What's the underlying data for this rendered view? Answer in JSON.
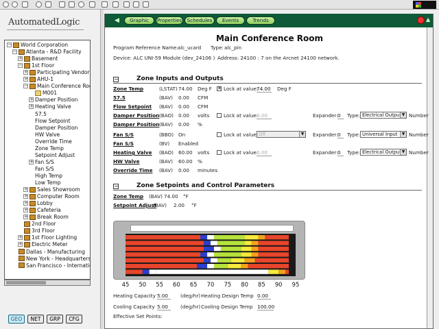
{
  "left": {
    "brand": "AutomatedLogic",
    "tree": [
      {
        "label": "World Corporation",
        "depth": 0,
        "exp": "−",
        "icon": "folder"
      },
      {
        "label": "Atlanta - R&D Facility",
        "depth": 1,
        "exp": "−",
        "icon": "folder"
      },
      {
        "label": "Basement",
        "depth": 2,
        "exp": "+",
        "icon": "folder"
      },
      {
        "label": "1st Floor",
        "depth": 2,
        "exp": "−",
        "icon": "folder"
      },
      {
        "label": "Participating Vendors",
        "depth": 3,
        "exp": "+",
        "icon": "folder"
      },
      {
        "label": "AHU-1",
        "depth": 3,
        "exp": "+",
        "icon": "folder"
      },
      {
        "label": "Main Conference Room",
        "depth": 3,
        "exp": "−",
        "icon": "folder"
      },
      {
        "label": "M001",
        "depth": 4,
        "exp": "",
        "icon": "box"
      },
      {
        "label": "Damper Position",
        "depth": 4,
        "exp": "+",
        "icon": ""
      },
      {
        "label": "Heating Valve",
        "depth": 4,
        "exp": "+",
        "icon": ""
      },
      {
        "label": "57.5",
        "depth": 4,
        "exp": "",
        "icon": ""
      },
      {
        "label": "Flow Setpoint",
        "depth": 4,
        "exp": "",
        "icon": ""
      },
      {
        "label": "Damper Position",
        "depth": 4,
        "exp": "",
        "icon": ""
      },
      {
        "label": "HW Valve",
        "depth": 4,
        "exp": "",
        "icon": ""
      },
      {
        "label": "Override Time",
        "depth": 4,
        "exp": "",
        "icon": ""
      },
      {
        "label": "Zone Temp",
        "depth": 4,
        "exp": "",
        "icon": ""
      },
      {
        "label": "Setpoint Adjust",
        "depth": 4,
        "exp": "",
        "icon": ""
      },
      {
        "label": "Fan S/S",
        "depth": 4,
        "exp": "+",
        "icon": ""
      },
      {
        "label": "Fan S/S",
        "depth": 4,
        "exp": "",
        "icon": ""
      },
      {
        "label": "High Temp",
        "depth": 4,
        "exp": "",
        "icon": ""
      },
      {
        "label": "Low Temp",
        "depth": 4,
        "exp": "",
        "icon": ""
      },
      {
        "label": "Sales Showroom",
        "depth": 3,
        "exp": "+",
        "icon": "folder"
      },
      {
        "label": "Computer Room",
        "depth": 3,
        "exp": "+",
        "icon": "folder"
      },
      {
        "label": "Lobby",
        "depth": 3,
        "exp": "+",
        "icon": "folder"
      },
      {
        "label": "Cafeteria",
        "depth": 3,
        "exp": "+",
        "icon": "folder"
      },
      {
        "label": "Break Room",
        "depth": 3,
        "exp": "+",
        "icon": "folder"
      },
      {
        "label": "2nd Floor",
        "depth": 2,
        "exp": "",
        "icon": "folder"
      },
      {
        "label": "3rd Floor",
        "depth": 2,
        "exp": "",
        "icon": "folder"
      },
      {
        "label": "1st Floor Lighting",
        "depth": 2,
        "exp": "+",
        "icon": "folder"
      },
      {
        "label": "Electric Meter",
        "depth": 2,
        "exp": "+",
        "icon": "folder"
      },
      {
        "label": "Dallas - Manufacturing",
        "depth": 1,
        "exp": "",
        "icon": "folder"
      },
      {
        "label": "New York - Headquarters",
        "depth": 1,
        "exp": "",
        "icon": "folder"
      },
      {
        "label": "San Francisco - International",
        "depth": 1,
        "exp": "",
        "icon": "folder"
      }
    ],
    "tabs": [
      "GEO",
      "NET",
      "GRP",
      "CFG"
    ]
  },
  "header": {
    "tabs": [
      "Graphic",
      "Properties",
      "Schedules",
      "Events",
      "Trends"
    ],
    "active_tab": "Properties"
  },
  "page": {
    "title": "Main Conference Room",
    "ref_label": "Program Reference Name:",
    "ref_value": "alc_ucard",
    "type_label": "Type:",
    "type_value": "alc_pin",
    "device_line": "Device: ALC UNI-59 Module (dev_24106 )",
    "address_line": "Address: 24100 : 7  on the Arcnet 24100  network."
  },
  "section1": {
    "title": "Zone Inputs and Outputs",
    "rows": [
      {
        "name": "Zone Temp",
        "type": "(LSTAT)",
        "value": "74.00",
        "unit": "Deg F",
        "lock": true,
        "lock_label": "Lock at value:",
        "lock_value": "74.00",
        "lock_unit": "Deg F"
      },
      {
        "name": "57.5",
        "type": "(BAV)",
        "value": "0.00",
        "unit": "CFM"
      },
      {
        "name": "Flow Setpoint",
        "type": "(BAV)",
        "value": "0.00",
        "unit": "CFM"
      },
      {
        "name": "Damper Position",
        "type": "(BAO)",
        "value": "0.00",
        "unit": "volts",
        "lock": false,
        "lock_label": "Lock at value:",
        "lock_value": "0.00",
        "exp_label": "Expander:",
        "exp_value": "0",
        "type_label": "Type:",
        "sel_value": "Electrical Output",
        "num_label": "Number"
      },
      {
        "name": "Damper Position",
        "type": "(BAV)",
        "value": "0.00",
        "unit": "%"
      },
      {
        "name": "Fan S/S",
        "type": "(BBO)",
        "value": "On",
        "unit": "",
        "lock": false,
        "lock_label": "Lock at value:",
        "lock_value": "Off",
        "exp_label": "Expander:",
        "exp_value": "0",
        "type_label": "Type:",
        "sel_value": "Universal Input",
        "num_label": "Number"
      },
      {
        "name": "Fan S/S",
        "type": "(BV)",
        "value": "Enabled",
        "unit": ""
      },
      {
        "name": "Heating Valve",
        "type": "(BAO)",
        "value": "60.00",
        "unit": "volts",
        "lock": false,
        "lock_label": "Lock at value:",
        "lock_value": "0.00",
        "exp_label": "Expander:",
        "exp_value": "0",
        "type_label": "Type:",
        "sel_value": "Electrical Output",
        "num_label": "Number"
      },
      {
        "name": "HW Valve",
        "type": "(BAV)",
        "value": "60.00",
        "unit": "%"
      },
      {
        "name": "Override Time",
        "type": "(BAV)",
        "value": "0.00",
        "unit": "minutes"
      }
    ]
  },
  "section2": {
    "title": "Zone Setpoints and Control Parameters",
    "rows": [
      {
        "name": "Zone Temp",
        "type": "(BAV)",
        "value": "74.00",
        "unit": "°F"
      },
      {
        "name": "Setpoint Adjust",
        "type": "(BAV)",
        "value": "2.00",
        "unit": "°F"
      }
    ]
  },
  "chart_data": {
    "type": "bar",
    "x_ticks": [
      "45",
      "50",
      "55",
      "60",
      "65",
      "70",
      "75",
      "80",
      "85",
      "90",
      "95"
    ],
    "x_range": [
      45,
      95
    ],
    "rows": [
      [
        {
          "from": 45,
          "to": 67,
          "color": "#e8452a"
        },
        {
          "from": 67,
          "to": 69,
          "color": "#2a3fd0"
        },
        {
          "from": 69,
          "to": 71,
          "color": "#ffffff"
        },
        {
          "from": 71,
          "to": 80,
          "color": "#b6e23c"
        },
        {
          "from": 80,
          "to": 84,
          "color": "#f4ea3a"
        },
        {
          "from": 84,
          "to": 86,
          "color": "#f3a21c"
        },
        {
          "from": 86,
          "to": 93,
          "color": "#e8452a"
        }
      ],
      [
        {
          "from": 45,
          "to": 68,
          "color": "#e8452a"
        },
        {
          "from": 68,
          "to": 70,
          "color": "#2a3fd0"
        },
        {
          "from": 70,
          "to": 72,
          "color": "#ffffff"
        },
        {
          "from": 72,
          "to": 80,
          "color": "#b6e23c"
        },
        {
          "from": 80,
          "to": 82,
          "color": "#f4ea3a"
        },
        {
          "from": 82,
          "to": 84,
          "color": "#f3a21c"
        },
        {
          "from": 84,
          "to": 93,
          "color": "#e8452a"
        }
      ],
      [
        {
          "from": 45,
          "to": 68,
          "color": "#e8452a"
        },
        {
          "from": 68,
          "to": 71,
          "color": "#2a3fd0"
        },
        {
          "from": 71,
          "to": 73,
          "color": "#ffffff"
        },
        {
          "from": 73,
          "to": 79,
          "color": "#b6e23c"
        },
        {
          "from": 79,
          "to": 82,
          "color": "#f4ea3a"
        },
        {
          "from": 82,
          "to": 84,
          "color": "#f3a21c"
        },
        {
          "from": 84,
          "to": 93,
          "color": "#e8452a"
        }
      ],
      [
        {
          "from": 45,
          "to": 67,
          "color": "#e8452a"
        },
        {
          "from": 67,
          "to": 69,
          "color": "#2a3fd0"
        },
        {
          "from": 69,
          "to": 71,
          "color": "#ffffff"
        },
        {
          "from": 71,
          "to": 79,
          "color": "#b6e23c"
        },
        {
          "from": 79,
          "to": 82,
          "color": "#f4ea3a"
        },
        {
          "from": 82,
          "to": 84,
          "color": "#f3a21c"
        },
        {
          "from": 84,
          "to": 93,
          "color": "#e8452a"
        }
      ],
      [
        {
          "from": 45,
          "to": 68,
          "color": "#e8452a"
        },
        {
          "from": 68,
          "to": 70,
          "color": "#2a3fd0"
        },
        {
          "from": 70,
          "to": 72,
          "color": "#ffffff"
        },
        {
          "from": 72,
          "to": 76,
          "color": "#b6e23c"
        },
        {
          "from": 76,
          "to": 80,
          "color": "#f4ea3a"
        },
        {
          "from": 80,
          "to": 83,
          "color": "#f3a21c"
        },
        {
          "from": 83,
          "to": 93,
          "color": "#e8452a"
        }
      ],
      [
        {
          "from": 45,
          "to": 66,
          "color": "#e8452a"
        },
        {
          "from": 66,
          "to": 69,
          "color": "#2a3fd0"
        },
        {
          "from": 69,
          "to": 71,
          "color": "#ffffff"
        },
        {
          "from": 71,
          "to": 75,
          "color": "#b6e23c"
        },
        {
          "from": 75,
          "to": 79,
          "color": "#f4ea3a"
        },
        {
          "from": 79,
          "to": 81,
          "color": "#f3a21c"
        },
        {
          "from": 81,
          "to": 93,
          "color": "#e8452a"
        }
      ],
      [
        {
          "from": 45,
          "to": 50,
          "color": "#e8452a"
        },
        {
          "from": 50,
          "to": 52,
          "color": "#2a3fd0"
        },
        {
          "from": 52,
          "to": 54,
          "color": "#ffffff"
        },
        {
          "from": 54,
          "to": 87,
          "color": "#ffffff"
        },
        {
          "from": 87,
          "to": 90,
          "color": "#f4ea3a"
        },
        {
          "from": 90,
          "to": 92,
          "color": "#f3a21c"
        },
        {
          "from": 92,
          "to": 93,
          "color": "#e8452a"
        }
      ]
    ]
  },
  "bottom": {
    "heat_cap_label": "Heating Capacity",
    "heat_cap_value": "5.00",
    "heat_cap_unit": "(deg/hr)",
    "heat_design_label": "Heating Design Temp",
    "heat_design_value": "0.00",
    "cool_cap_label": "Cooling Capacity",
    "cool_cap_value": "5.00",
    "cool_cap_unit": "(deg/hr)",
    "cool_design_label": "Cooling Design Temp",
    "cool_design_value": "100.00",
    "eff_label": "Effective Set Points:"
  }
}
